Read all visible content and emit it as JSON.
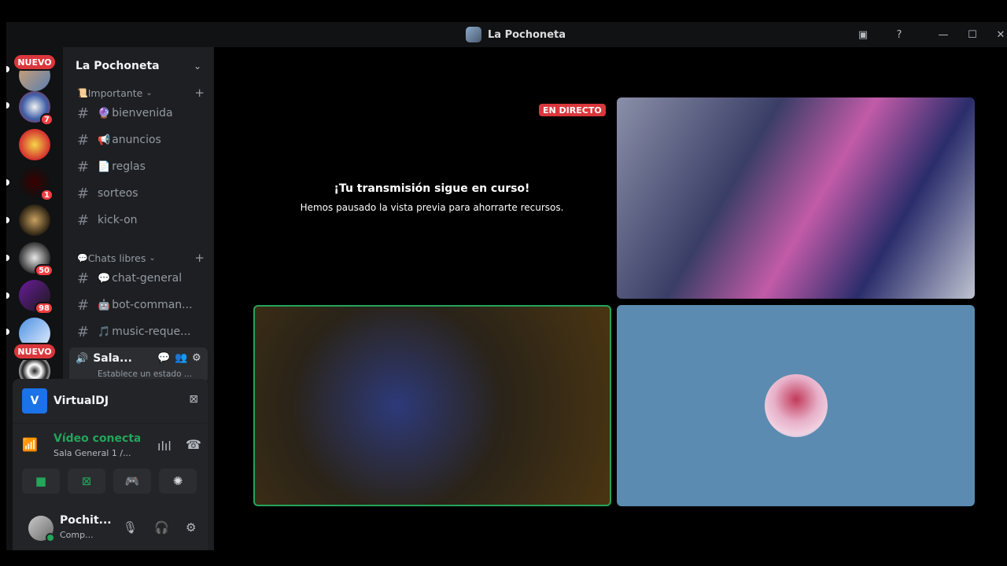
{
  "window": {
    "title": "La Pochoneta"
  },
  "rail": {
    "nuevo_top": "NUEVO",
    "nuevo_bottom": "NUEVO",
    "badges": [
      "7",
      "1",
      "50",
      "98"
    ]
  },
  "sidebar": {
    "server_name": "La Pochoneta",
    "categories": [
      {
        "label": "Importante",
        "emoji": "📜"
      },
      {
        "label": "Chats libres",
        "emoji": "💬"
      }
    ],
    "channels": [
      {
        "emoji": "🔮",
        "name": "bienvenida"
      },
      {
        "emoji": "📢",
        "name": "anuncios"
      },
      {
        "emoji": "📄",
        "name": "reglas"
      },
      {
        "emoji": "",
        "name": "sorteos"
      },
      {
        "emoji": "",
        "name": "kick-on"
      },
      {
        "emoji": "💬",
        "name": "chat-general"
      },
      {
        "emoji": "🤖",
        "name": "bot-comman..."
      },
      {
        "emoji": "🎵",
        "name": "music-reque..."
      }
    ],
    "voice_channel": {
      "name": "Sala...",
      "status": "Establece un estado ..."
    }
  },
  "panel": {
    "app_name": "VirtualDJ",
    "app_logo_letter": "V",
    "connection_title": "Vídeo conectado",
    "connection_sub": "Sala General 1 /...",
    "user_name": "Pochit...",
    "user_status": "Comp..."
  },
  "stage": {
    "live_badge": "EN DIRECTO",
    "paused_title": "¡Tu transmisión sigue en curso!",
    "paused_sub": "Hemos pausado la vista previa para ahorrarte recursos."
  },
  "colors": {
    "accent_green": "#23a55a",
    "badge_red": "#f23f43",
    "avatar_tile_bg": "#5b8bb0"
  }
}
